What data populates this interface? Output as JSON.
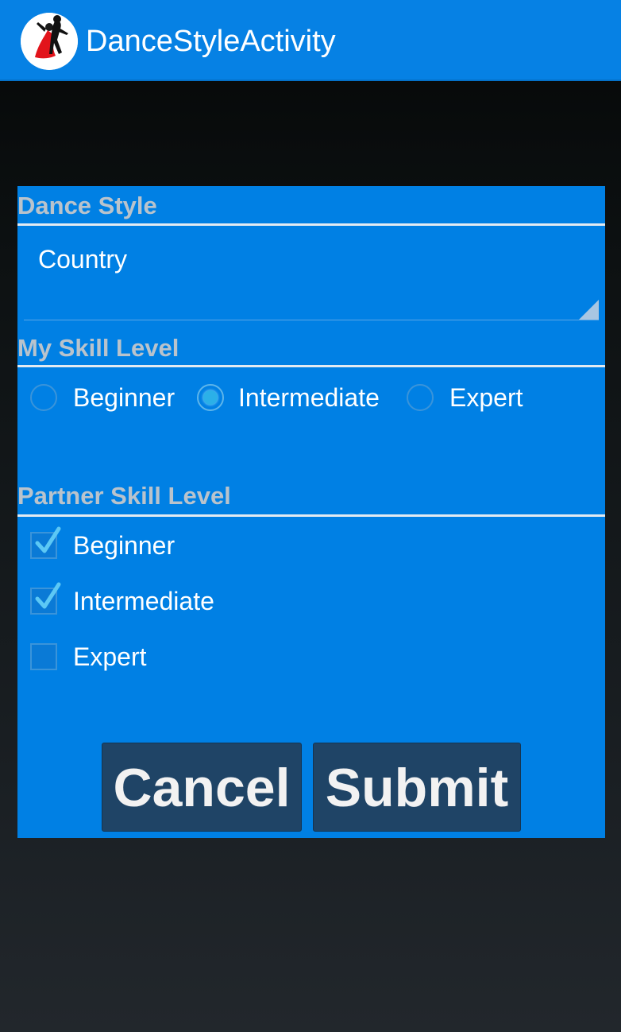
{
  "app": {
    "title": "DanceStyleActivity",
    "icon": "dancing-couple-icon"
  },
  "form": {
    "dance_style": {
      "header": "Dance Style",
      "selected": "Country"
    },
    "my_skill": {
      "header": "My Skill Level",
      "options": [
        "Beginner",
        "Intermediate",
        "Expert"
      ],
      "selected": "Intermediate"
    },
    "partner_skill": {
      "header": "Partner Skill Level",
      "options": [
        {
          "label": "Beginner",
          "checked": true
        },
        {
          "label": "Intermediate",
          "checked": true
        },
        {
          "label": "Expert",
          "checked": false
        }
      ]
    },
    "buttons": {
      "cancel": "Cancel",
      "submit": "Submit"
    }
  },
  "colors": {
    "action_bar": "#0681e4",
    "panel": "#0080e4",
    "header_text": "#b9c3cc",
    "button": "#1f4466",
    "radio_checked": "#2bb0e8"
  }
}
